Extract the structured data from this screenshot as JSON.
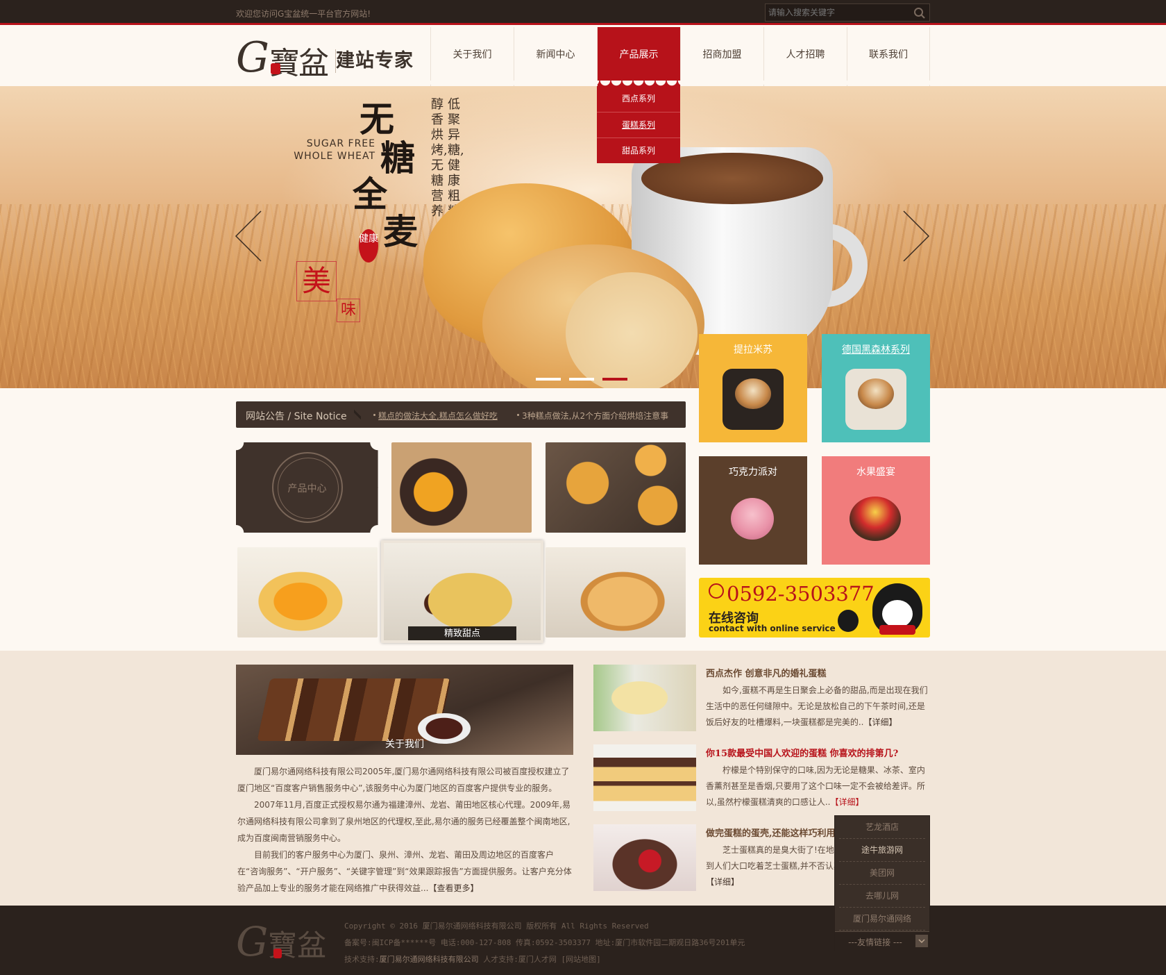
{
  "topbar": {
    "welcome": "欢迎您访问G宝盆统一平台官方网站!",
    "search_placeholder": "请输入搜索关键字"
  },
  "logo": {
    "g": "G",
    "name": "寶盆",
    "tagline": "建站专家"
  },
  "nav": {
    "items": [
      "关于我们",
      "新闻中心",
      "产品展示",
      "招商加盟",
      "人才招聘",
      "联系我们"
    ],
    "active_index": 2,
    "dropdown": [
      "西点系列",
      "蛋糕系列",
      "甜品系列"
    ]
  },
  "banner": {
    "slogan_en_1": "SUGAR FREE",
    "slogan_en_2": "WHOLE WHEAT",
    "big_1": "无",
    "big_2": "糖",
    "big_3": "全",
    "big_4": "麦",
    "vertical_1": "低聚异糖,健康粗粮",
    "vertical_2": "醇香烘烤,无糖营养",
    "mei": "美",
    "wei": "味",
    "seal": "健康",
    "active_slide": 3,
    "slide_count": 3
  },
  "tiles": [
    {
      "label": "提拉米苏",
      "color": "#f6b738"
    },
    {
      "label": "德国黑森林系列",
      "color": "#4ec0b9"
    },
    {
      "label": "巧克力派对",
      "color": "#5b3f2b"
    },
    {
      "label": "水果盛宴",
      "color": "#f17c7c"
    }
  ],
  "consult": {
    "phone": "0592-3503377",
    "title": "在线咨询",
    "subtitle": "contact with online service"
  },
  "notice": {
    "label": "网站公告 / Site Notice",
    "items": [
      "糕点的做法大全,糕点怎么做好吃",
      "3种糕点做法,从2个方面介绍烘焙注意事"
    ]
  },
  "gallery": {
    "center_label": "产品中心",
    "caption": "精致甜点"
  },
  "about": {
    "caption": "关于我们",
    "paragraphs": [
      "厦门易尔通网络科技有限公司2005年,厦门易尔通网络科技有限公司被百度授权建立了厦门地区“百度客户销售服务中心”,该服务中心为厦门地区的百度客户提供专业的服务。",
      "2007年11月,百度正式授权易尔通为福建漳州、龙岩、莆田地区核心代理。2009年,易尔通网络科技有限公司拿到了泉州地区的代理权,至此,易尔通的服务已经覆盖整个闽南地区,成为百度闽南营销服务中心。",
      "目前我们的客户服务中心为厦门、泉州、漳州、龙岩、莆田及周边地区的百度客户在“咨询服务”、“开户服务”、“关键字管理”到“效果跟踪报告”方面提供服务。让客户充分体验产品加上专业的服务才能在网络推广中获得效益..."
    ],
    "more": "【查看更多】"
  },
  "news": [
    {
      "title": "西点杰作 创意非凡的婚礼蛋糕",
      "body": "如今,蛋糕不再是生日聚会上必备的甜品,而是出现在我们生活中的恶任何缝隙中。无论是放松自己的下午茶时间,还是饭后好友的吐槽爆料,一块蛋糕都是完美的..",
      "detail": "【详细】"
    },
    {
      "title": "你15款最受中国人欢迎的蛋糕 你喜欢的排第几?",
      "body": "柠檬是个特别保守的口味,因为无论是糖果、冰茶、室内香薰剂甚至是香烟,只要用了这个口味一定不会被给差评。所以,虽然柠檬蛋糕清爽的口感让人..",
      "detail": "【详细】"
    },
    {
      "title": "做完蛋糕的蛋壳,还能这样巧利用",
      "body": "芝士蛋糕真的是臭大街了!在地铁上,在飞机上,你总能看到人们大口吃着芝士蛋糕,并不否认其或绵软或紧实的口感,",
      "detail": "【详细】"
    }
  ],
  "friend_links": {
    "items": [
      "艺龙酒店",
      "途牛旅游网",
      "美团网",
      "去哪儿网",
      "厦门易尔通网络"
    ],
    "select_label": "---友情链接 ---"
  },
  "footer": {
    "copyright": "Copyright © 2016 厦门易尔通网络科技有限公司 版权所有 All Rights Reserved",
    "record": "备案号:闽ICP备******号 电话:000-127-808 传真:0592-3503377 地址:厦门市软件园二期观日路36号201单元",
    "support_label": "技术支持:",
    "support_company": "厦门易尔通网络科技有限公司",
    "talent": "人才支持:厦门人才网 [网站地图]"
  },
  "colors": {
    "brand_red": "#b7121a",
    "dark_brown": "#2b221d",
    "cream": "#fdf8f2"
  }
}
